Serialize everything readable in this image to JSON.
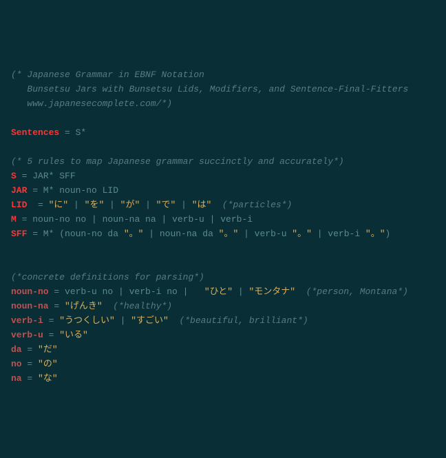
{
  "lines": [
    {
      "tokens": [
        {
          "cls": "cmt",
          "t": "(* Japanese Grammar in EBNF Notation"
        }
      ]
    },
    {
      "tokens": [
        {
          "cls": "cmt",
          "t": "   Bunsetsu Jars with Bunsetsu Lids, Modifiers, and Sentence-Final-Fitters"
        }
      ]
    },
    {
      "tokens": [
        {
          "cls": "cmt",
          "t": "   www.japanesecomplete.com/*)"
        }
      ]
    },
    {
      "tokens": [
        {
          "cls": "cmt",
          "t": ""
        }
      ]
    },
    {
      "tokens": [
        {
          "cls": "kw",
          "t": "Sentences"
        },
        {
          "cls": "op",
          "t": " = "
        },
        {
          "cls": "op",
          "t": "S*"
        }
      ]
    },
    {
      "tokens": [
        {
          "cls": "cmt",
          "t": ""
        }
      ]
    },
    {
      "tokens": [
        {
          "cls": "cmt",
          "t": "(* 5 rules to map Japanese grammar succinctly and accurately*)"
        }
      ]
    },
    {
      "tokens": [
        {
          "cls": "kw",
          "t": "S"
        },
        {
          "cls": "op",
          "t": " = JAR* SFF"
        }
      ]
    },
    {
      "tokens": [
        {
          "cls": "kw",
          "t": "JAR"
        },
        {
          "cls": "op",
          "t": " = M* noun-no LID"
        }
      ]
    },
    {
      "tokens": [
        {
          "cls": "kw",
          "t": "LID"
        },
        {
          "cls": "op",
          "t": "  = "
        },
        {
          "cls": "str",
          "t": "\"に\""
        },
        {
          "cls": "op",
          "t": " | "
        },
        {
          "cls": "str",
          "t": "\"を\""
        },
        {
          "cls": "op",
          "t": " | "
        },
        {
          "cls": "str",
          "t": "\"が\""
        },
        {
          "cls": "op",
          "t": " | "
        },
        {
          "cls": "str",
          "t": "\"で\""
        },
        {
          "cls": "op",
          "t": " | "
        },
        {
          "cls": "str",
          "t": "\"は\""
        },
        {
          "cls": "cmt",
          "t": "  (*particles*)"
        }
      ]
    },
    {
      "tokens": [
        {
          "cls": "kw",
          "t": "M"
        },
        {
          "cls": "op",
          "t": " = noun-no no | noun-na na | verb-u | verb-i"
        }
      ]
    },
    {
      "tokens": [
        {
          "cls": "kw",
          "t": "SFF"
        },
        {
          "cls": "op",
          "t": " = M* (noun-no da "
        },
        {
          "cls": "str",
          "t": "\"。\""
        },
        {
          "cls": "op",
          "t": " | noun-na da "
        },
        {
          "cls": "str",
          "t": "\"。\""
        },
        {
          "cls": "op",
          "t": " | verb-u "
        },
        {
          "cls": "str",
          "t": "\"。\""
        },
        {
          "cls": "op",
          "t": " | verb-i "
        },
        {
          "cls": "str",
          "t": "\"。\""
        },
        {
          "cls": "op",
          "t": ")"
        }
      ]
    },
    {
      "tokens": [
        {
          "cls": "cmt",
          "t": ""
        }
      ]
    },
    {
      "tokens": [
        {
          "cls": "cmt",
          "t": ""
        }
      ]
    },
    {
      "tokens": [
        {
          "cls": "cmt",
          "t": "(*concrete definitions for parsing*)"
        }
      ]
    },
    {
      "tokens": [
        {
          "cls": "id",
          "t": "noun-no"
        },
        {
          "cls": "op",
          "t": " = verb-u no | verb-i no |   "
        },
        {
          "cls": "str",
          "t": "\"ひと\""
        },
        {
          "cls": "op",
          "t": " | "
        },
        {
          "cls": "str",
          "t": "\"モンタナ\""
        },
        {
          "cls": "cmt",
          "t": "  (*person, Montana*)"
        }
      ]
    },
    {
      "tokens": [
        {
          "cls": "id",
          "t": "noun-na"
        },
        {
          "cls": "op",
          "t": " = "
        },
        {
          "cls": "str",
          "t": "\"げんき\""
        },
        {
          "cls": "cmt",
          "t": "  (*healthy*)"
        }
      ]
    },
    {
      "tokens": [
        {
          "cls": "id",
          "t": "verb-i"
        },
        {
          "cls": "op",
          "t": " = "
        },
        {
          "cls": "str",
          "t": "\"うつくしい\""
        },
        {
          "cls": "op",
          "t": " | "
        },
        {
          "cls": "str",
          "t": "\"すごい\""
        },
        {
          "cls": "cmt",
          "t": "  (*beautiful, brilliant*)"
        }
      ]
    },
    {
      "tokens": [
        {
          "cls": "id",
          "t": "verb-u"
        },
        {
          "cls": "op",
          "t": " = "
        },
        {
          "cls": "str",
          "t": "\"いる\""
        }
      ]
    },
    {
      "tokens": [
        {
          "cls": "id",
          "t": "da"
        },
        {
          "cls": "op",
          "t": " = "
        },
        {
          "cls": "str",
          "t": "\"だ\""
        }
      ]
    },
    {
      "tokens": [
        {
          "cls": "id",
          "t": "no"
        },
        {
          "cls": "op",
          "t": " = "
        },
        {
          "cls": "str",
          "t": "\"の\""
        }
      ]
    },
    {
      "tokens": [
        {
          "cls": "id",
          "t": "na"
        },
        {
          "cls": "op",
          "t": " = "
        },
        {
          "cls": "str",
          "t": "\"な\""
        }
      ]
    }
  ]
}
